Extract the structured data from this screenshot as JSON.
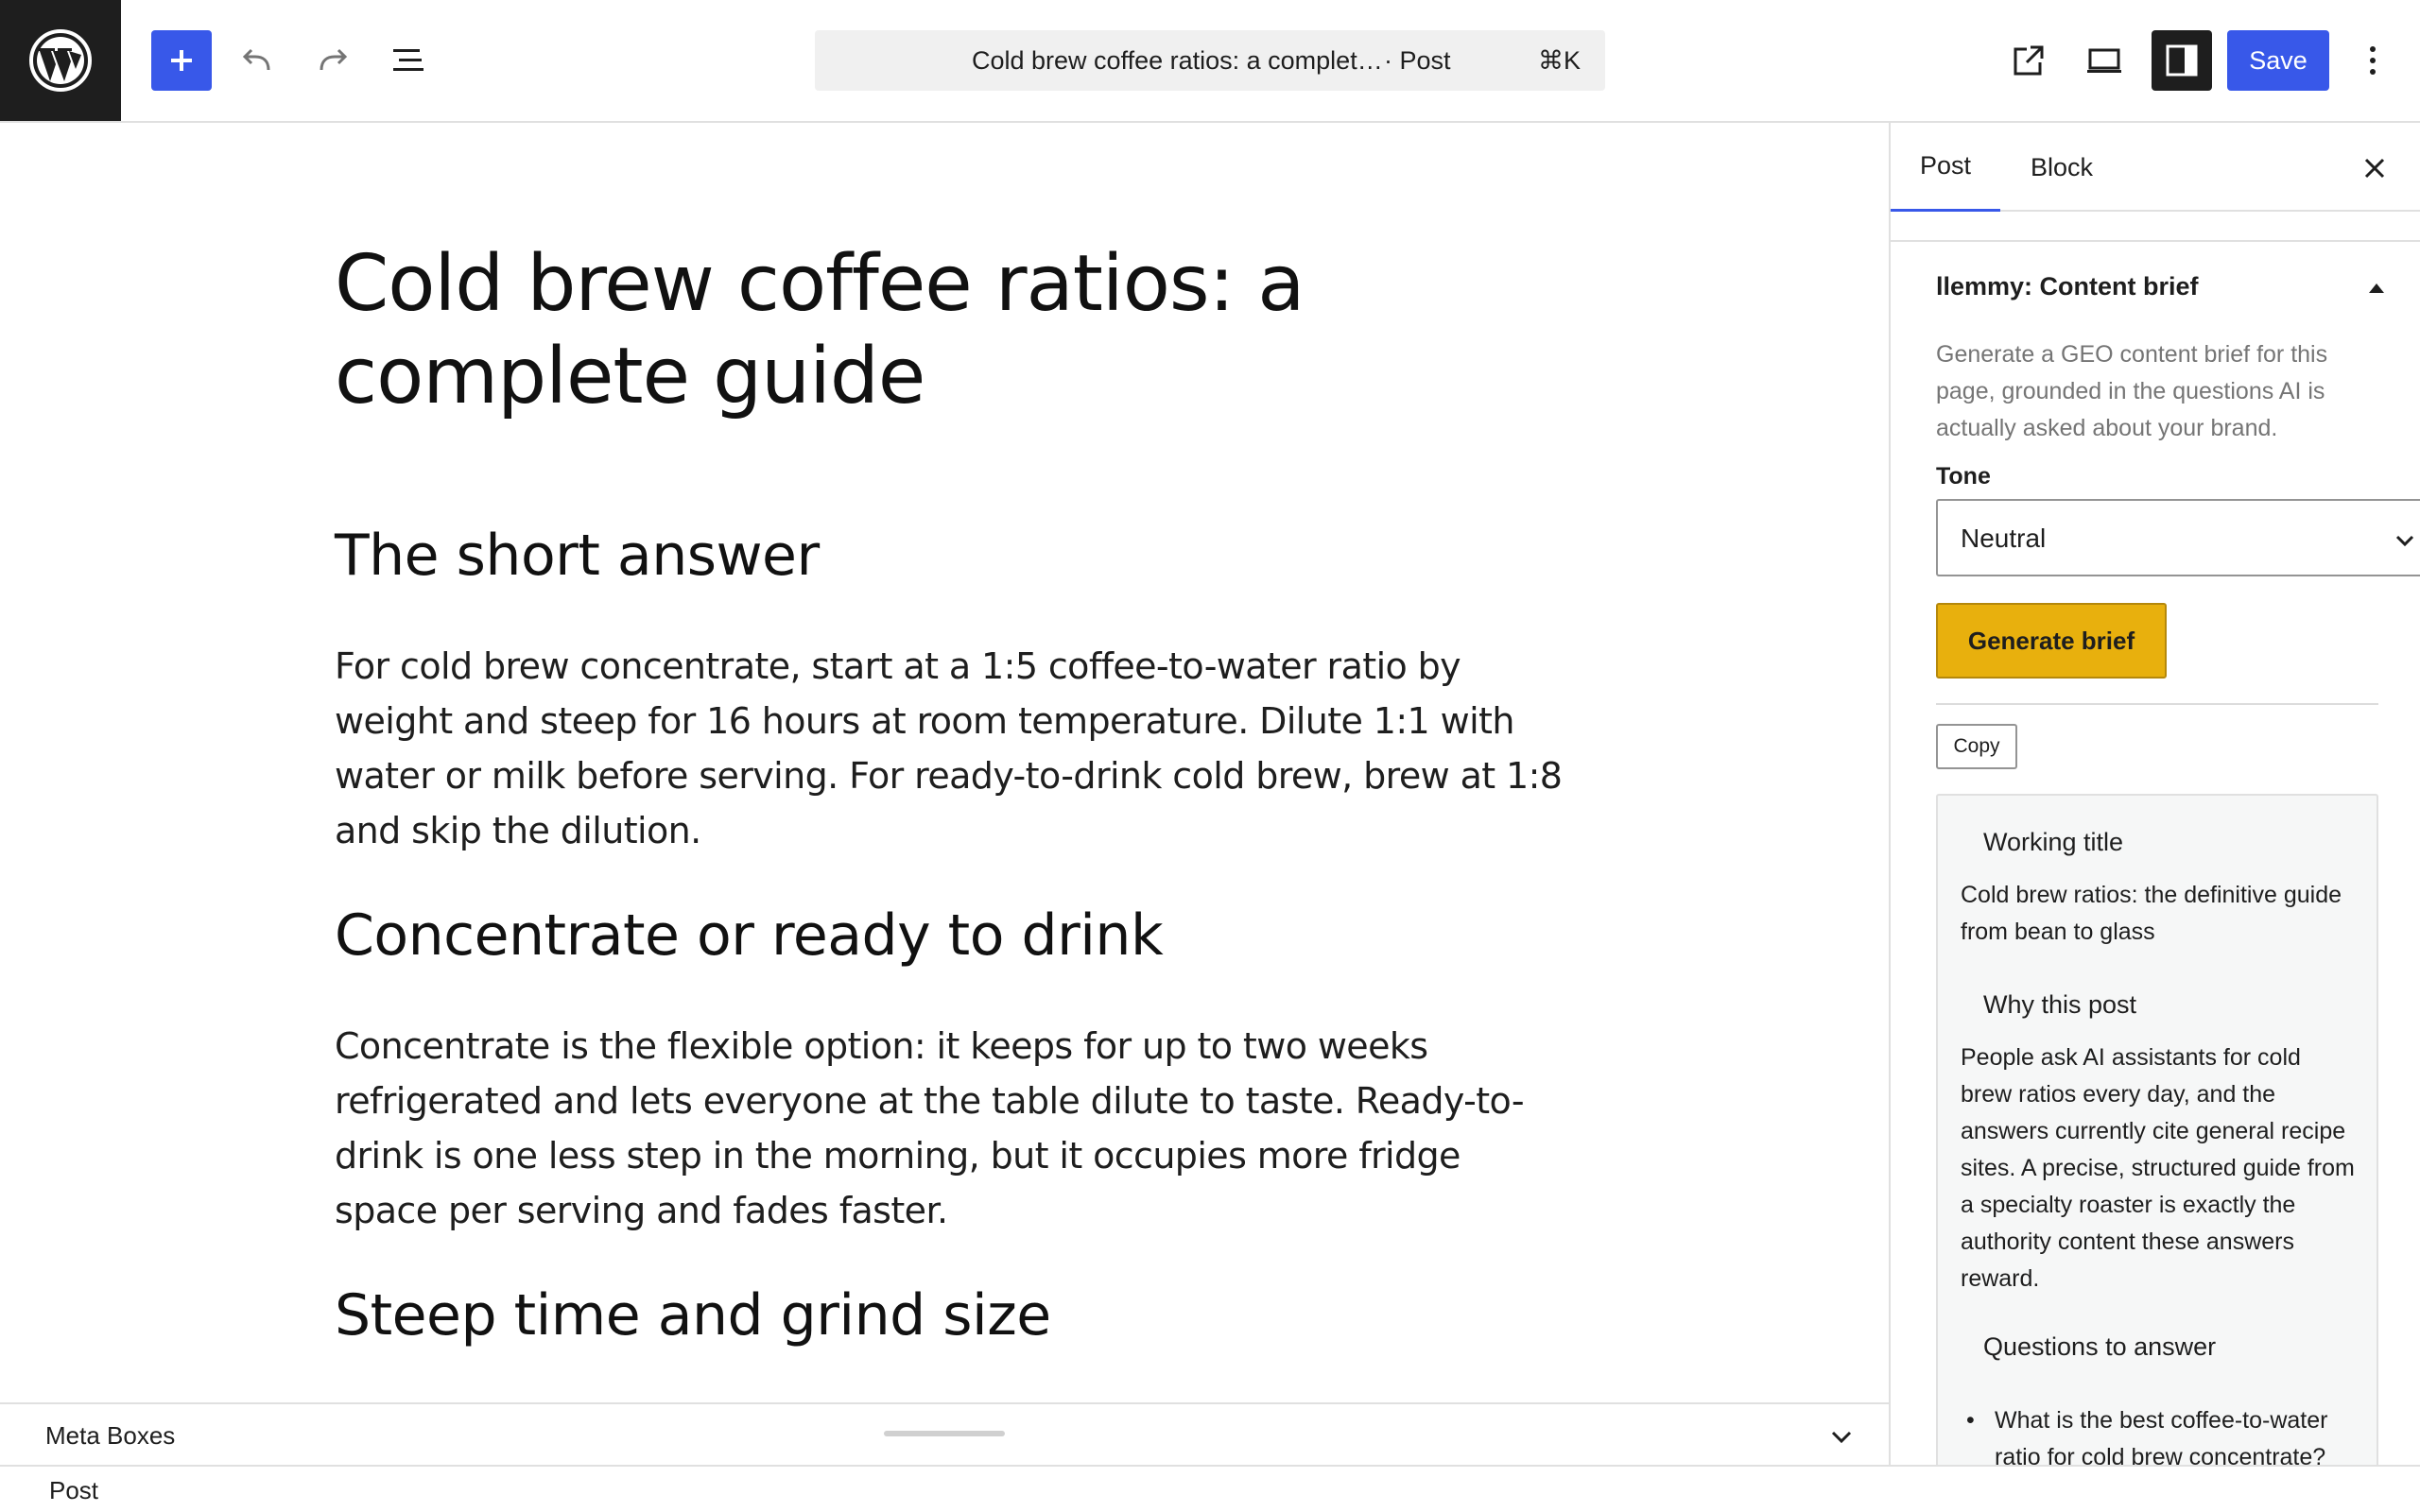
{
  "toolbar": {
    "logo_icon": "wordpress-logo-icon",
    "add_icon": "plus-icon",
    "undo_icon": "undo-icon",
    "redo_icon": "redo-icon",
    "list_view_icon": "document-overview-icon",
    "command": {
      "title": "Cold brew coffee ratios: a complet…",
      "type": "· Post",
      "shortcut": "⌘K"
    },
    "view_icon": "external-link-icon",
    "device_icon": "desktop-icon",
    "sidebar_icon": "sidebar-toggle-icon",
    "save_label": "Save",
    "more_icon": "more-vertical-icon",
    "accent_color": "#3858e9"
  },
  "post": {
    "title": "Cold brew coffee ratios: a complete guide",
    "sections": [
      {
        "heading": "The short answer",
        "body": "For cold brew concentrate, start at a 1:5 coffee-to-water ratio by weight and steep for 16 hours at room temperature. Dilute 1:1 with water or milk before serving. For ready-to-drink cold brew, brew at 1:8 and skip the dilution."
      },
      {
        "heading": "Concentrate or ready to drink",
        "body": "Concentrate is the flexible option: it keeps for up to two weeks refrigerated and lets everyone at the table dilute to taste. Ready-to-drink is one less step in the morning, but it occupies more fridge space per serving and fades faster."
      },
      {
        "heading": "Steep time and grind size"
      }
    ]
  },
  "sidebar": {
    "tabs": [
      "Post",
      "Block"
    ],
    "active_tab": "Post",
    "close_icon": "close-icon",
    "panel": {
      "title": "llemmy: Content brief",
      "toggle_icon": "caret-up-icon",
      "description": "Generate a GEO content brief for this page, grounded in the questions AI is actually asked about your brand.",
      "tone_label": "Tone",
      "tone_value": "Neutral",
      "generate_label": "Generate brief",
      "generate_color": "#e8b00d",
      "copy_label": "Copy",
      "brief": {
        "working_title_heading": "Working title",
        "working_title": "Cold brew ratios: the definitive guide from bean to glass",
        "why_heading": "Why this post",
        "why_body": "People ask AI assistants for cold brew ratios every day, and the answers currently cite general recipe sites. A precise, structured guide from a specialty roaster is exactly the authority content these answers reward.",
        "questions_heading": "Questions to answer",
        "questions": [
          "What is the best coffee-to-water ratio for cold brew concentrate?"
        ]
      }
    }
  },
  "meta_boxes": {
    "label": "Meta Boxes",
    "chevron_icon": "chevron-down-icon"
  },
  "footer": {
    "breadcrumb": "Post"
  }
}
